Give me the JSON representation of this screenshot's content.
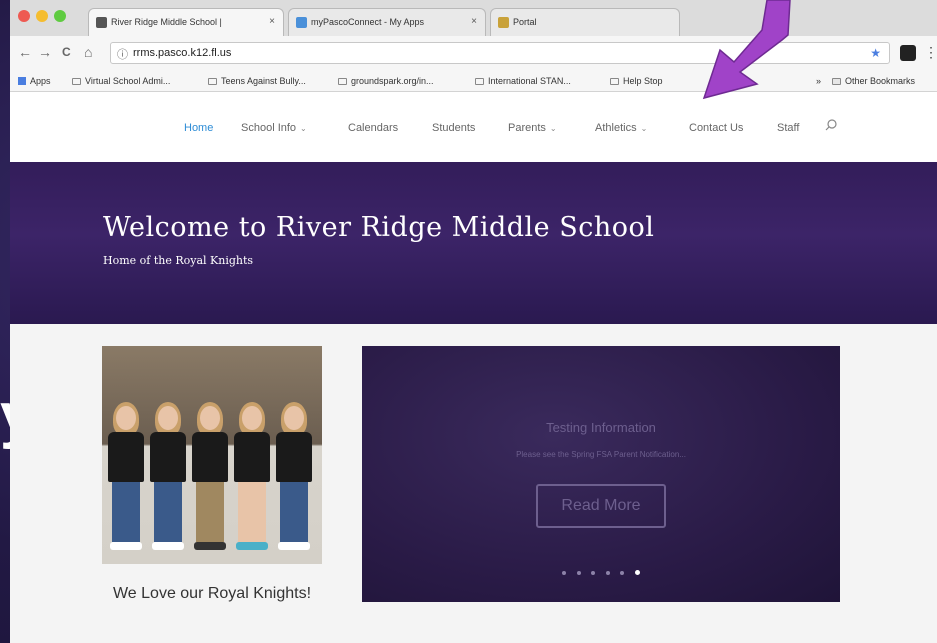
{
  "browser": {
    "tabs": [
      {
        "label": "River Ridge Middle School |",
        "close": "×",
        "active": true,
        "icon_color": "#555555"
      },
      {
        "label": "myPascoConnect - My Apps",
        "close": "×",
        "active": false,
        "icon_color": "#4a90d9"
      },
      {
        "label": "Portal",
        "close": "",
        "active": false,
        "icon_color": "#c9a23a"
      }
    ],
    "nav": {
      "back": "←",
      "forward": "→",
      "reload": "C",
      "home": "⌂"
    },
    "address": {
      "info_icon": "ⓘ",
      "url": "rrms.pasco.k12.fl.us",
      "star": "★"
    },
    "menu": "⋮",
    "bookmarks": [
      {
        "label": "Apps"
      },
      {
        "label": "Virtual School Admi..."
      },
      {
        "label": "Teens Against Bully..."
      },
      {
        "label": "groundspark.org/in..."
      },
      {
        "label": "International STAN..."
      },
      {
        "label": "Help Stop"
      },
      {
        "label": "Other Bookmarks"
      }
    ],
    "bookmarks_overflow": "»"
  },
  "site": {
    "nav": [
      {
        "label": "Home",
        "active": true,
        "has_caret": false
      },
      {
        "label": "School Info",
        "active": false,
        "has_caret": true
      },
      {
        "label": "Calendars",
        "active": false,
        "has_caret": false
      },
      {
        "label": "Students",
        "active": false,
        "has_caret": false
      },
      {
        "label": "Parents",
        "active": false,
        "has_caret": true
      },
      {
        "label": "Athletics",
        "active": false,
        "has_caret": true
      },
      {
        "label": "Contact Us",
        "active": false,
        "has_caret": false
      },
      {
        "label": "Staff",
        "active": false,
        "has_caret": false
      }
    ],
    "caret": "⌄",
    "hero": {
      "title": "Welcome to River Ridge Middle School",
      "subtitle": "Home of the Royal Knights"
    },
    "photo_caption": "We Love our Royal Knights!",
    "slider": {
      "title": "Testing Information",
      "description": "Please see the Spring FSA Parent Notification...",
      "button": "Read More",
      "dot_count": 6,
      "active_dot": 5
    }
  },
  "background_slide_text": "y",
  "colors": {
    "nav_active": "#2d8cd6",
    "hero_purple": "#3c2468",
    "arrow": "#a043c8"
  }
}
